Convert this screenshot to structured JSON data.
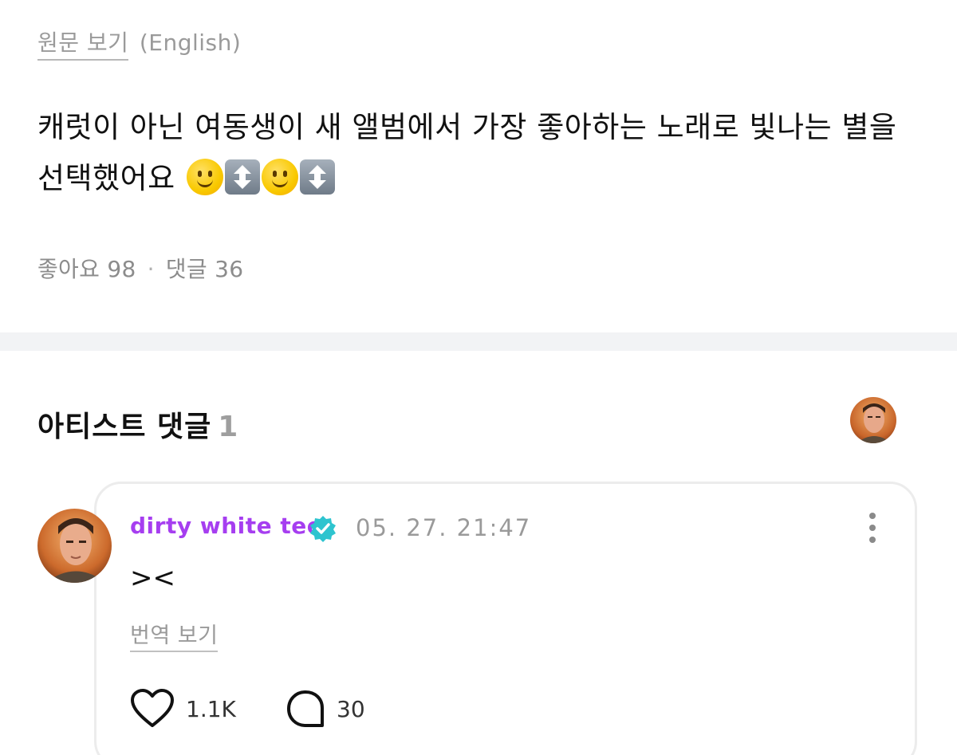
{
  "post": {
    "translation_toggle": {
      "label": "원문 보기",
      "language": "(English)"
    },
    "body_text": "캐럿이 아닌 여동생이 새 앨범에서 가장 좋아하는 노래로 빛나는 별을 선택했어요",
    "body_emojis": [
      "slightly-smiling-face",
      "up-down-arrow",
      "slightly-smiling-face",
      "up-down-arrow"
    ],
    "stats": {
      "likes": "좋아요 98",
      "separator": "·",
      "comments": "댓글 36"
    }
  },
  "artist_comments": {
    "title": "아티스트 댓글",
    "count": "1",
    "comment": {
      "author": "dirty white tee",
      "verified": true,
      "timestamp": "05. 27. 21:47",
      "text": "><",
      "translate_label": "번역 보기",
      "likes": "1.1K",
      "replies": "30"
    }
  },
  "colors": {
    "author": "#a63ef0",
    "verified_badge": "#2ec4cf",
    "muted_text": "#9a9a9a",
    "divider": "#f2f3f5"
  }
}
